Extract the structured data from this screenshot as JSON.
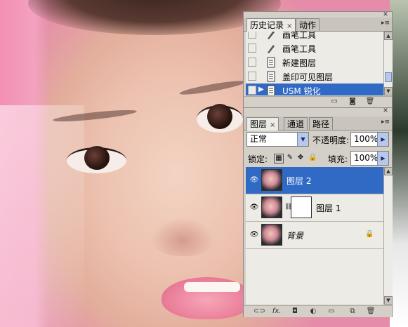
{
  "history_panel": {
    "tabs": [
      {
        "label": "历史记录",
        "close": "×"
      },
      {
        "label": "动作"
      }
    ],
    "items": [
      {
        "label": "画笔工具",
        "icon": "brush-icon"
      },
      {
        "label": "画笔工具",
        "icon": "brush-icon"
      },
      {
        "label": "新建图层",
        "icon": "document-icon"
      },
      {
        "label": "盖印可见图层",
        "icon": "document-icon"
      },
      {
        "label": "USM 锐化",
        "icon": "document-icon",
        "selected": true
      }
    ]
  },
  "layers_panel": {
    "tabs": [
      {
        "label": "图层",
        "close": "×"
      },
      {
        "label": "通道"
      },
      {
        "label": "路径"
      }
    ],
    "blend_mode": "正常",
    "opacity_label": "不透明度:",
    "opacity_value": "100%",
    "lock_label": "锁定:",
    "fill_label": "填充:",
    "fill_value": "100%",
    "layers": [
      {
        "name": "图层 2",
        "selected": true,
        "visible": true
      },
      {
        "name": "图层 1",
        "has_mask": true,
        "visible": true
      },
      {
        "name": "背景",
        "locked": true,
        "visible": true
      }
    ],
    "bottom_icons": [
      "link-icon",
      "fx-icon",
      "add-mask-icon",
      "adjustment-icon",
      "folder-icon",
      "new-layer-icon",
      "trash-icon"
    ],
    "fx_label": "fx."
  },
  "colors": {
    "selection": "#316ac5",
    "panel_bg": "#d4d0c8",
    "list_bg": "#ecebe6"
  }
}
